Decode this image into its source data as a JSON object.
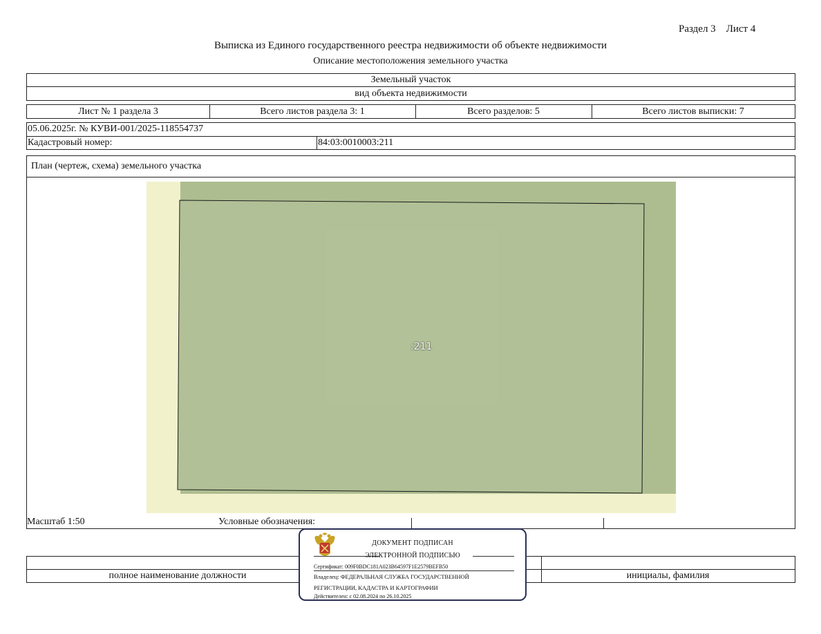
{
  "header": {
    "section_label": "Раздел 3",
    "sheet_label": "Лист 4",
    "title": "Выписка из Единого государственного реестра недвижимости об объекте недвижимости",
    "subtitle": "Описание местоположения земельного участка"
  },
  "object": {
    "kind": "Земельный участок",
    "kind_caption": "вид объекта недвижимости"
  },
  "counts": {
    "sheet": "Лист № 1 раздела 3",
    "section_sheets": "Всего листов раздела 3: 1",
    "sections": "Всего разделов: 5",
    "extract_sheets": "Всего листов выписки: 7"
  },
  "record": {
    "date_number": "05.06.2025г. № КУВИ-001/2025-118554737",
    "cadastral_label": "Кадастровый номер:",
    "cadastral_value": "84:03:0010003:211"
  },
  "plan": {
    "title": "План (чертеж, схема) земельного участка",
    "parcel_label": ":211",
    "colors": {
      "yellow": "#f1f1cc",
      "green_bg": "#aebd90",
      "parcel": "#b1c096",
      "outline": "#1a1a1a"
    }
  },
  "legend": {
    "scale": "Масштаб 1:50",
    "legend_label": "Условные обозначения:"
  },
  "signature": {
    "position_caption": "полное наименование должности",
    "name_caption": "инициалы, фамилия"
  },
  "stamp": {
    "line1": "ДОКУМЕНТ ПОДПИСАН",
    "line2": "ЭЛЕКТРОННОЙ ПОДПИСЬЮ",
    "certificate": "Сертификат: 009F0BDC181A023B64597F1E2579BEFB50",
    "owner_line1": "Владелец: ФЕДЕРАЛЬНАЯ СЛУЖБА ГОСУДАРСТВЕННОЙ",
    "owner_line2": "РЕГИСТРАЦИИ, КАДАСТРА И КАРТОГРАФИИ",
    "validity": "Действителен: с 02.08.2024 по 26.10.2025",
    "emblem": "double-headed-eagle-emblem",
    "border_color": "#2b2f56"
  }
}
